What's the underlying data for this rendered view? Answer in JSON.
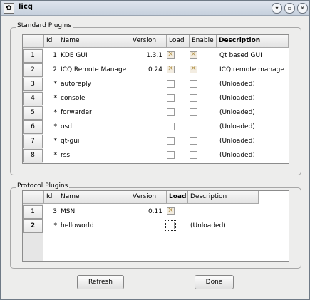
{
  "window": {
    "title": "licq",
    "icon": "app-icon",
    "controls": [
      "chevron-down-icon",
      "restore-icon",
      "close-icon"
    ]
  },
  "standard": {
    "label": "Standard Plugins",
    "headers": {
      "id": "Id",
      "name": "Name",
      "version": "Version",
      "load": "Load",
      "enable": "Enable",
      "description": "Description"
    },
    "rows": [
      {
        "num": "1",
        "id": "1",
        "name": "KDE GUI",
        "version": "1.3.1",
        "load": true,
        "enable": true,
        "description": "Qt based GUI"
      },
      {
        "num": "2",
        "id": "2",
        "name": "ICQ Remote Manage",
        "version": "0.24",
        "load": true,
        "enable": true,
        "description": "ICQ remote manage"
      },
      {
        "num": "3",
        "id": "*",
        "name": "autoreply",
        "version": "",
        "load": false,
        "enable": false,
        "description": "(Unloaded)"
      },
      {
        "num": "4",
        "id": "*",
        "name": "console",
        "version": "",
        "load": false,
        "enable": false,
        "description": "(Unloaded)"
      },
      {
        "num": "5",
        "id": "*",
        "name": "forwarder",
        "version": "",
        "load": false,
        "enable": false,
        "description": "(Unloaded)"
      },
      {
        "num": "6",
        "id": "*",
        "name": "osd",
        "version": "",
        "load": false,
        "enable": false,
        "description": "(Unloaded)"
      },
      {
        "num": "7",
        "id": "*",
        "name": "qt-gui",
        "version": "",
        "load": false,
        "enable": false,
        "description": "(Unloaded)"
      },
      {
        "num": "8",
        "id": "*",
        "name": "rss",
        "version": "",
        "load": false,
        "enable": false,
        "description": "(Unloaded)"
      }
    ]
  },
  "protocol": {
    "label": "Protocol Plugins",
    "headers": {
      "id": "Id",
      "name": "Name",
      "version": "Version",
      "load": "Load",
      "description": "Description"
    },
    "rows": [
      {
        "num": "1",
        "id": "3",
        "name": "MSN",
        "version": "0.11",
        "load": true,
        "description": ""
      },
      {
        "num": "2",
        "id": "*",
        "name": "helloworld",
        "version": "",
        "load": false,
        "description": "(Unloaded)"
      }
    ]
  },
  "buttons": {
    "refresh": "Refresh",
    "done": "Done"
  }
}
